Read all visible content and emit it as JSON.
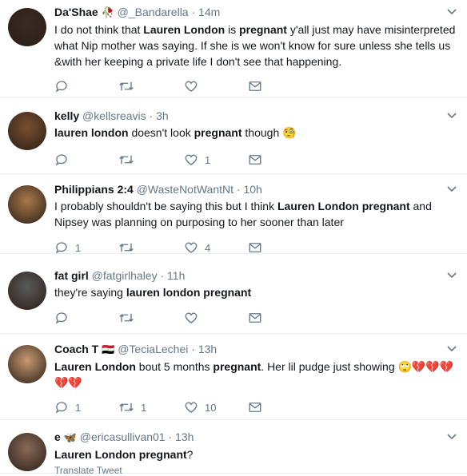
{
  "tweets": [
    {
      "name": "Da'Shae",
      "name_emoji": "🥀",
      "handle": "@_Bandarella",
      "time": "14m",
      "avatar": "#3a2a22",
      "text_parts": [
        {
          "t": "I do not think that ",
          "b": false
        },
        {
          "t": "Lauren London",
          "b": true
        },
        {
          "t": " is ",
          "b": false
        },
        {
          "t": "pregnant",
          "b": true
        },
        {
          "t": " y'all just may have misinterpreted what Nip mother was saying. If she is we won't know for sure unless she tells us &with her keeping a private life I don't see that happening.",
          "b": false
        }
      ],
      "reply_count": "",
      "retweet_count": "",
      "like_count": ""
    },
    {
      "name": "kelly",
      "name_emoji": "",
      "handle": "@kellsreavis",
      "time": "3h",
      "avatar": "#7a5030",
      "text_parts": [
        {
          "t": "lauren london",
          "b": true
        },
        {
          "t": " doesn't look ",
          "b": false
        },
        {
          "t": "pregnant",
          "b": true
        },
        {
          "t": " though ",
          "b": false
        },
        {
          "t": "🧐",
          "b": false
        }
      ],
      "reply_count": "",
      "retweet_count": "",
      "like_count": "1"
    },
    {
      "name": "Philippians 2:4",
      "name_emoji": "",
      "handle": "@WasteNotWantNt",
      "time": "10h",
      "avatar": "#a87a4a",
      "text_parts": [
        {
          "t": "I probably shouldn't be saying this but I think ",
          "b": false
        },
        {
          "t": "Lauren London pregnant",
          "b": true
        },
        {
          "t": " and Nipsey was planning on purposing to her sooner than later",
          "b": false
        }
      ],
      "reply_count": "1",
      "retweet_count": "",
      "like_count": "4"
    },
    {
      "name": "fat girl",
      "name_emoji": "",
      "handle": "@fatgirlhaley",
      "time": "11h",
      "avatar": "#5a5a5a",
      "text_parts": [
        {
          "t": "they're saying ",
          "b": false
        },
        {
          "t": "lauren london pregnant",
          "b": true
        }
      ],
      "reply_count": "",
      "retweet_count": "",
      "like_count": ""
    },
    {
      "name": "Coach T",
      "name_emoji": "🇪🇬",
      "handle": "@TeciaLechei",
      "time": "13h",
      "avatar": "#c89a70",
      "text_parts": [
        {
          "t": "Lauren London",
          "b": true
        },
        {
          "t": " bout 5 months ",
          "b": false
        },
        {
          "t": "pregnant",
          "b": true
        },
        {
          "t": ". Her lil pudge just showing ",
          "b": false
        },
        {
          "t": "🙄💔💔💔💔💔",
          "b": false
        }
      ],
      "reply_count": "1",
      "retweet_count": "1",
      "like_count": "10"
    },
    {
      "name": "e",
      "name_emoji": "🦋",
      "handle": "@ericasullivan01",
      "time": "13h",
      "avatar": "#8a6a58",
      "text_parts": [
        {
          "t": "Lauren London pregnant",
          "b": true
        },
        {
          "t": "?",
          "b": false
        }
      ],
      "translate_label": "Translate Tweet",
      "reply_count": "",
      "retweet_count": "",
      "like_count": ""
    }
  ],
  "separator_dot": "·",
  "icons": {
    "reply": "reply-icon",
    "retweet": "retweet-icon",
    "like": "heart-icon",
    "dm": "envelope-icon",
    "chevron": "chevron-down-icon"
  },
  "colors": {
    "muted": "#657786",
    "border": "#e6ecf0",
    "text": "#14171a"
  }
}
